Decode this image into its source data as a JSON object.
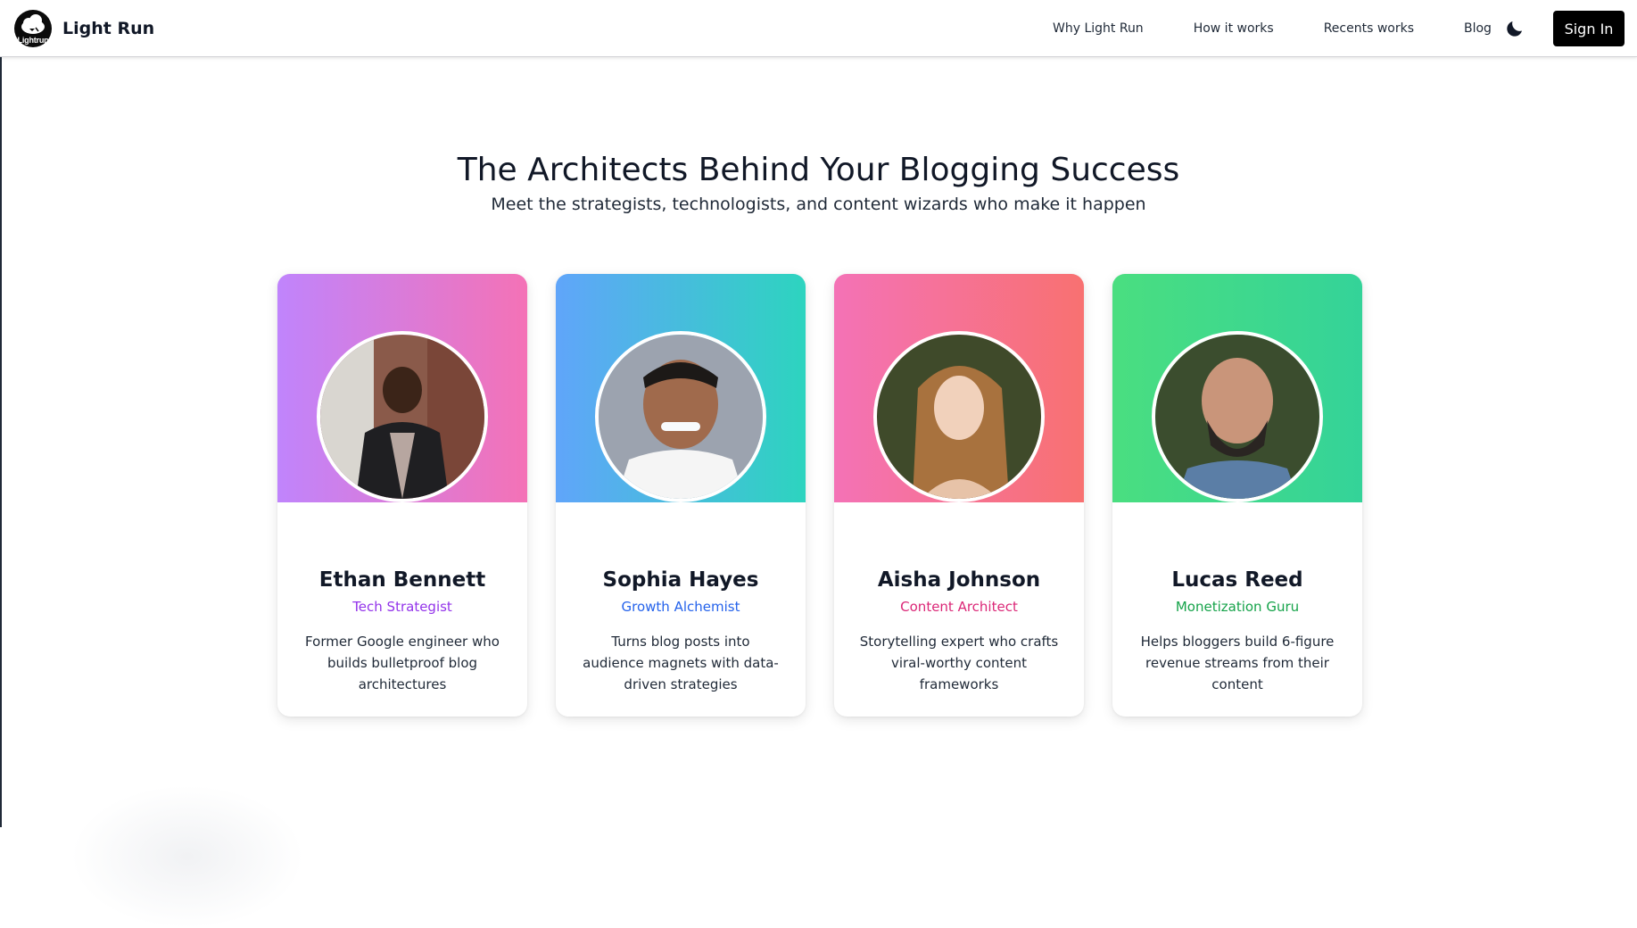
{
  "header": {
    "logo_text": "Lightrun",
    "brand_name": "Light Run",
    "nav": [
      {
        "label": "Why Light Run"
      },
      {
        "label": "How it works"
      },
      {
        "label": "Recents works"
      },
      {
        "label": "Blog"
      }
    ],
    "theme_icon": "moon-icon",
    "sign_in_label": "Sign In"
  },
  "hero": {
    "title": "The Architects Behind Your Blogging Success",
    "subtitle": "Meet the strategists, technologists, and content wizards who make it happen"
  },
  "team": [
    {
      "name": "Ethan Bennett",
      "role": "Tech Strategist",
      "role_color": "#9333ea",
      "gradient": [
        "#c084fc",
        "#f472b6"
      ],
      "description": "Former Google engineer who builds bulletproof blog architectures"
    },
    {
      "name": "Sophia Hayes",
      "role": "Growth Alchemist",
      "role_color": "#2563eb",
      "gradient": [
        "#60a5fa",
        "#2dd4bf"
      ],
      "description": "Turns blog posts into audience magnets with data-driven strategies"
    },
    {
      "name": "Aisha Johnson",
      "role": "Content Architect",
      "role_color": "#db2777",
      "gradient": [
        "#f472b6",
        "#f87171"
      ],
      "description": "Storytelling expert who crafts viral-worthy content frameworks"
    },
    {
      "name": "Lucas Reed",
      "role": "Monetization Guru",
      "role_color": "#16a34a",
      "gradient": [
        "#4ade80",
        "#34d399"
      ],
      "description": "Helps bloggers build 6-figure revenue streams from their content"
    }
  ]
}
